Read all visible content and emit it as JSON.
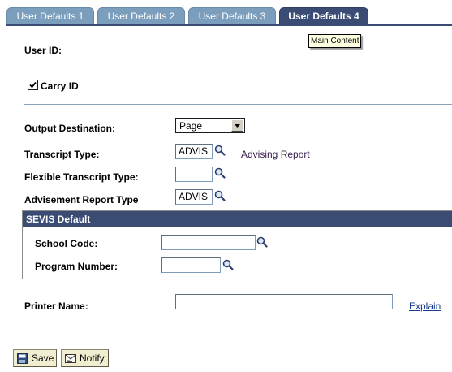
{
  "tabs": [
    {
      "label": "User Defaults 1"
    },
    {
      "label": "User Defaults 2"
    },
    {
      "label": "User Defaults 3"
    },
    {
      "label": "User Defaults 4"
    }
  ],
  "tooltip": "Main Content",
  "user_id": {
    "label": "User ID:"
  },
  "carry_id": {
    "label": "Carry ID",
    "checked": true
  },
  "output_destination": {
    "label": "Output Destination:",
    "value": "Page"
  },
  "transcript_type": {
    "label": "Transcript Type:",
    "value": "ADVIS",
    "description": "Advising Report"
  },
  "flexible_transcript_type": {
    "label": "Flexible Transcript Type:",
    "value": ""
  },
  "advisement_report_type": {
    "label": "Advisement Report Type",
    "value": "ADVIS"
  },
  "sevis": {
    "header": "SEVIS Default",
    "school_code": {
      "label": "School Code:",
      "value": ""
    },
    "program_number": {
      "label": "Program Number:",
      "value": ""
    }
  },
  "printer_name": {
    "label": "Printer Name:",
    "value": "",
    "explain_link": "Explain"
  },
  "buttons": {
    "save": "Save",
    "notify": "Notify"
  },
  "colors": {
    "tab_inactive": "#7b9ebd",
    "tab_active": "#3a4b74",
    "section_header": "#3a4b74",
    "button_bg": "#f1edd0"
  },
  "icons": {
    "lookup": "magnifier-icon",
    "save": "save-icon",
    "notify": "notify-icon",
    "checkbox": "checkmark-icon"
  }
}
